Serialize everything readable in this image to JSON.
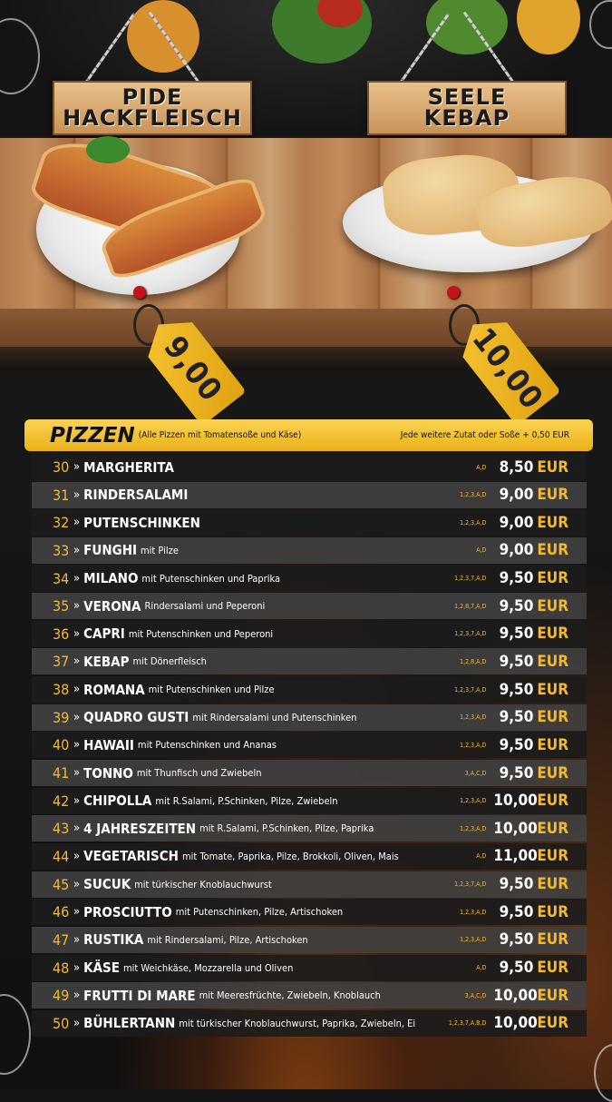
{
  "signs": {
    "left": [
      "PIDE",
      "HACKFLEISCH"
    ],
    "right": [
      "SEELE",
      "KEBAP"
    ]
  },
  "tags": {
    "left_price": "9,00",
    "right_price": "10,00"
  },
  "header": {
    "title": "PIZZEN",
    "subtitle": "(Alle Pizzen mit Tomatensoße und Käse)",
    "extra": "Jede weitere Zutat oder Soße + 0,50 EUR"
  },
  "currency": "EUR",
  "items": [
    {
      "num": "30",
      "name": "MARGHERITA",
      "desc": "",
      "allergens": "A,D",
      "price": "8,50"
    },
    {
      "num": "31",
      "name": "RINDERSALAMI",
      "desc": "",
      "allergens": "1,2,3,A,D",
      "price": "9,00"
    },
    {
      "num": "32",
      "name": "PUTENSCHINKEN",
      "desc": "",
      "allergens": "1,2,3,A,D",
      "price": "9,00"
    },
    {
      "num": "33",
      "name": "FUNGHI",
      "desc": "mit Pilze",
      "allergens": "A,D",
      "price": "9,00"
    },
    {
      "num": "34",
      "name": "MILANO",
      "desc": "mit Putenschinken und Paprika",
      "allergens": "1,2,3,7,A,D",
      "price": "9,50"
    },
    {
      "num": "35",
      "name": "VERONA",
      "desc": "Rindersalami und Peperoni",
      "allergens": "1,2,8,7,A,D",
      "price": "9,50"
    },
    {
      "num": "36",
      "name": "CAPRI",
      "desc": "mit Putenschinken und Peperoni",
      "allergens": "1,2,3,7,A,D",
      "price": "9,50"
    },
    {
      "num": "37",
      "name": "KEBAP",
      "desc": "mit Dönerfleisch",
      "allergens": "1,2,8,A,D",
      "price": "9,50"
    },
    {
      "num": "38",
      "name": "ROMANA",
      "desc": "mit Putenschinken und Pilze",
      "allergens": "1,2,3,7,A,D",
      "price": "9,50"
    },
    {
      "num": "39",
      "name": "QUADRO GUSTI",
      "desc": "mit Rindersalami und Putenschinken",
      "allergens": "1,2,3,A,D",
      "price": "9,50"
    },
    {
      "num": "40",
      "name": "HAWAII",
      "desc": "mit Putenschinken und Ananas",
      "allergens": "1,2,3,A,D",
      "price": "9,50"
    },
    {
      "num": "41",
      "name": "TONNO",
      "desc": "mit Thunfisch und Zwiebeln",
      "allergens": "3,A,C,D",
      "price": "9,50"
    },
    {
      "num": "42",
      "name": "CHIPOLLA",
      "desc": "mit R.Salami, P.Schinken, Pilze, Zwiebeln",
      "allergens": "1,2,3,A,D",
      "price": "10,00"
    },
    {
      "num": "43",
      "name": "4 JAHRESZEITEN",
      "desc": "mit R.Salami, P.Schinken, Pilze, Paprika",
      "allergens": "1,2,3,A,D",
      "price": "10,00"
    },
    {
      "num": "44",
      "name": "VEGETARISCH",
      "desc": "mit Tomate, Paprika, Pilze, Brokkoli, Oliven, Mais",
      "allergens": "A,D",
      "price": "11,00"
    },
    {
      "num": "45",
      "name": "SUCUK",
      "desc": "mit türkischer Knoblauchwurst",
      "allergens": "1,2,3,7,A,D",
      "price": "9,50"
    },
    {
      "num": "46",
      "name": "PROSCIUTTO",
      "desc": "mit Putenschinken, Pilze, Artischoken",
      "allergens": "1,2,3,A,D",
      "price": "9,50"
    },
    {
      "num": "47",
      "name": "RUSTIKA",
      "desc": "mit Rindersalami, Pilze, Artischoken",
      "allergens": "1,2,3,A,D",
      "price": "9,50"
    },
    {
      "num": "48",
      "name": "KÄSE",
      "desc": "mit Weichkäse, Mozzarella und Oliven",
      "allergens": "A,D",
      "price": "9,50"
    },
    {
      "num": "49",
      "name": "FRUTTI DI MARE",
      "desc": "mit Meeresfrüchte, Zwiebeln, Knoblauch",
      "allergens": "3,A,C,D",
      "price": "10,00"
    },
    {
      "num": "50",
      "name": "BÜHLERTANN",
      "desc": "mit türkischer Knoblauchwurst, Paprika, Zwiebeln, Ei",
      "allergens": "1,2,3,7,A,B,D",
      "price": "10,00"
    }
  ],
  "colors": {
    "accent": "#f2b931",
    "header": "#f6c232"
  }
}
